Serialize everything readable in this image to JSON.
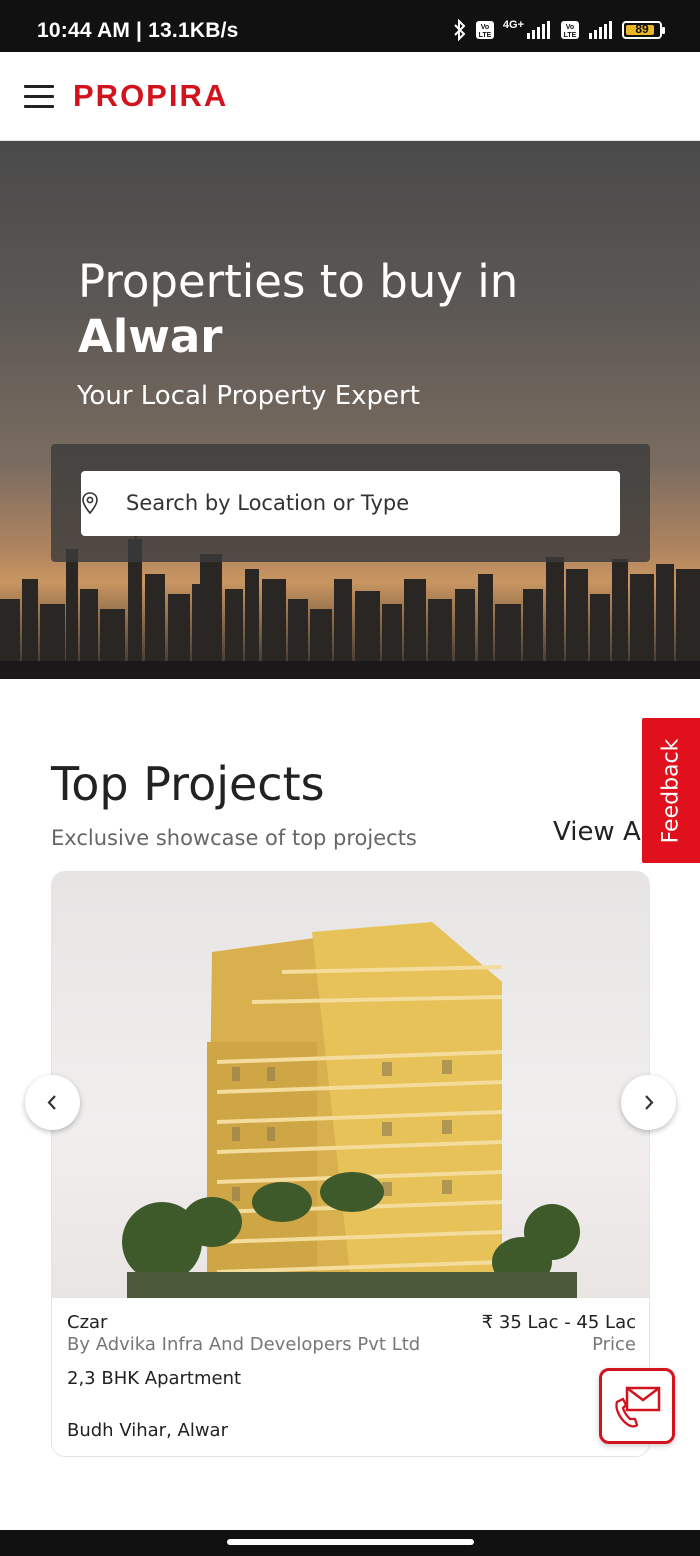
{
  "status_bar": {
    "time": "10:44 AM | 13.1KB/s",
    "network_label": "4G+",
    "battery_level": "89",
    "battery_fraction": 0.89,
    "battery_color": "#e9b627"
  },
  "header": {
    "logo": "PROPIRA",
    "brand_color": "#d2131d"
  },
  "hero": {
    "title_line1": "Properties to buy in",
    "title_line2": "Alwar",
    "subtitle": "Your Local Property Expert",
    "search_placeholder": "Search by Location or Type"
  },
  "feedback": {
    "label": "Feedback"
  },
  "top_projects": {
    "title": "Top Projects",
    "subtitle": "Exclusive showcase of top projects",
    "view_all": "View All",
    "projects": [
      {
        "name": "Czar",
        "developer": "By Advika Infra And Developers Pvt Ltd",
        "type": "2,3 BHK Apartment",
        "location": "Budh Vihar, Alwar",
        "price": "₹ 35 Lac - 45 Lac",
        "price_label": "Price"
      }
    ]
  },
  "icons": {
    "menu": "hamburger-menu-icon",
    "search": "location-pin-icon",
    "prev": "chevron-left-icon",
    "next": "chevron-right-icon",
    "contact": "phone-mail-icon"
  }
}
